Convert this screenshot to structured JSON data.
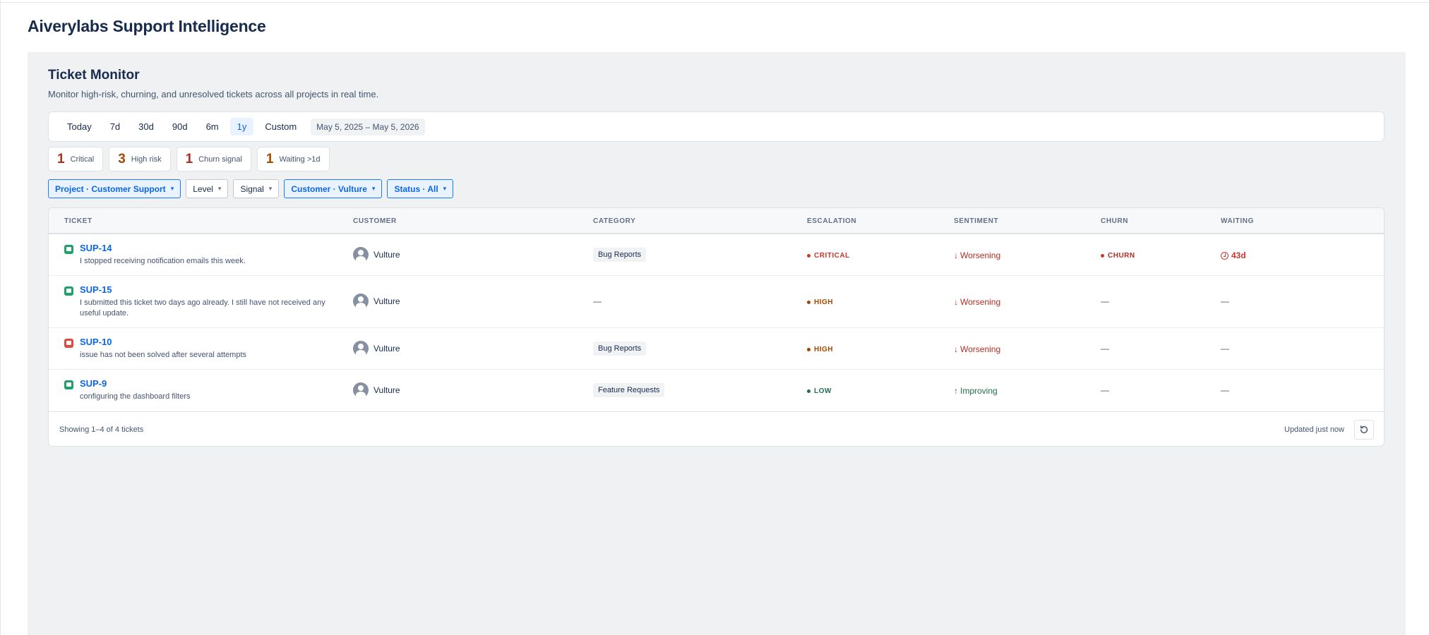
{
  "app": {
    "title": "Aiverylabs Support Intelligence"
  },
  "monitor": {
    "title": "Ticket Monitor",
    "subtitle": "Monitor high-risk, churning, and unresolved tickets across all projects in real time."
  },
  "range": {
    "options": [
      "Today",
      "7d",
      "30d",
      "90d",
      "6m",
      "1y",
      "Custom"
    ],
    "selected": "1y",
    "date_range": "May 5, 2025 – May 5, 2026"
  },
  "stats": [
    {
      "value": "1",
      "label": "Critical",
      "color": "#ae2e24"
    },
    {
      "value": "3",
      "label": "High risk",
      "color": "#a54800"
    },
    {
      "value": "1",
      "label": "Churn signal",
      "color": "#ae2e24"
    },
    {
      "value": "1",
      "label": "Waiting >1d",
      "color": "#a54800"
    }
  ],
  "filters": [
    {
      "label": "Project · Customer Support",
      "active": true
    },
    {
      "label": "Level",
      "active": false
    },
    {
      "label": "Signal",
      "active": false
    },
    {
      "label": "Customer · Vulture",
      "active": true
    },
    {
      "label": "Status · All",
      "active": true
    }
  ],
  "table": {
    "columns": [
      "TICKET",
      "CUSTOMER",
      "CATEGORY",
      "ESCALATION",
      "SENTIMENT",
      "CHURN",
      "WAITING"
    ],
    "rows": [
      {
        "key": "SUP-14",
        "summary": "I stopped receiving notification emails this week.",
        "icon": "task-icon",
        "icon_color": "#22a06b",
        "customer": "Vulture",
        "category": "Bug Reports",
        "escalation": "CRITICAL",
        "escalation_color": "#c9372c",
        "sentiment": "Worsening",
        "sentiment_arrow": "↓",
        "sentiment_color": "#ae2e24",
        "churn": "CHURN",
        "waiting": "43d"
      },
      {
        "key": "SUP-15",
        "summary": "I submitted this ticket two days ago already. I still have not received any useful update.",
        "icon": "task-icon",
        "icon_color": "#22a06b",
        "customer": "Vulture",
        "category": "—",
        "escalation": "HIGH",
        "escalation_color": "#a54800",
        "sentiment": "Worsening",
        "sentiment_arrow": "↓",
        "sentiment_color": "#ae2e24",
        "churn": "—",
        "waiting": "—"
      },
      {
        "key": "SUP-10",
        "summary": "issue has not been solved after several attempts",
        "icon": "bug-icon",
        "icon_color": "#e2483d",
        "customer": "Vulture",
        "category": "Bug Reports",
        "escalation": "HIGH",
        "escalation_color": "#a54800",
        "sentiment": "Worsening",
        "sentiment_arrow": "↓",
        "sentiment_color": "#ae2e24",
        "churn": "—",
        "waiting": "—"
      },
      {
        "key": "SUP-9",
        "summary": "configuring the dashboard filters",
        "icon": "task-icon",
        "icon_color": "#22a06b",
        "customer": "Vulture",
        "category": "Feature Requests",
        "escalation": "LOW",
        "escalation_color": "#216e4e",
        "sentiment": "Improving",
        "sentiment_arrow": "↑",
        "sentiment_color": "#216e4e",
        "churn": "—",
        "waiting": "—"
      }
    ]
  },
  "footer": {
    "showing": "Showing 1–4 of 4 tickets",
    "updated": "Updated just now"
  },
  "colors": {
    "accent": "#0c66e4",
    "critical": "#c9372c",
    "high": "#a54800",
    "low": "#216e4e"
  }
}
